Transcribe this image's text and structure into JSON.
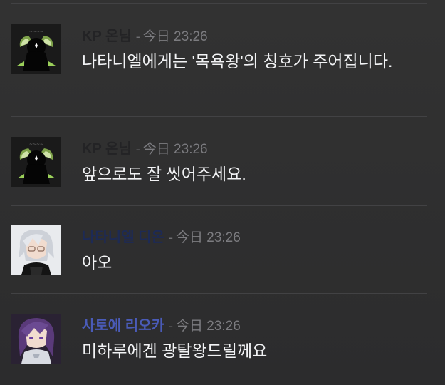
{
  "messages": [
    {
      "author": "KP 온님",
      "author_color": "#232325",
      "separator": "-",
      "timestamp": "今日 23:26",
      "avatar": "ghost-avatar",
      "text": "나타니엘에게는 '목욕왕'의 칭호가 주어집니다."
    },
    {
      "author": "KP 온님",
      "author_color": "#232325",
      "separator": "-",
      "timestamp": "今日 23:26",
      "avatar": "ghost-avatar",
      "text": "앞으로도 잘 씻어주세요."
    },
    {
      "author": "나타니엘 디온",
      "author_color": "#1d2a55",
      "separator": "-",
      "timestamp": "今日 23:26",
      "avatar": "white-haired-character-avatar",
      "text": "아오"
    },
    {
      "author": "사토에 리오카",
      "author_color": "#4a5bb8",
      "separator": "-",
      "timestamp": "今日 23:26",
      "avatar": "purple-haired-character-avatar",
      "text": "미하루에겐 광탈왕드릴께요"
    }
  ]
}
